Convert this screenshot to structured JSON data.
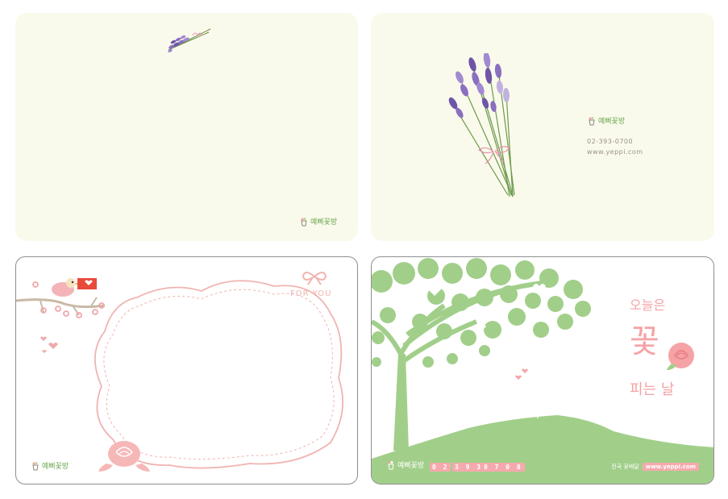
{
  "brand": {
    "name": "예삐꽃방"
  },
  "card2": {
    "phone": "02-393-0700",
    "website": "www.yeppi.com"
  },
  "card3": {
    "for_you": "FOR YOU"
  },
  "card4": {
    "line1": "오늘은",
    "line2": "꽃",
    "line3": "피는 날",
    "phone_parts": [
      "0 2",
      "3 9 3",
      "0 7 0 0"
    ],
    "nationwide": "전국 꽃배달",
    "website": "www.yeppi.com"
  },
  "colors": {
    "card_cream": "#fafaec",
    "lavender": "#8a6fc0",
    "pink": "#f6a9ad",
    "tree_green": "#a1cf8a",
    "brand_green": "#6aa84f"
  }
}
